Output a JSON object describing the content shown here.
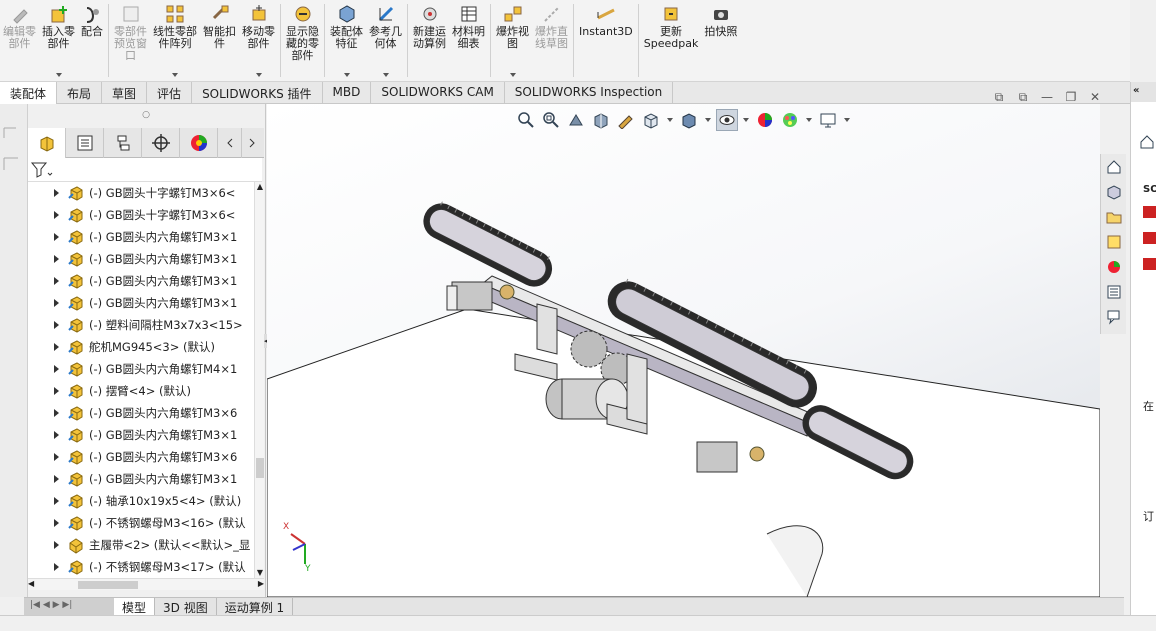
{
  "ribbon": {
    "buttons": [
      {
        "label": "编辑零\n部件",
        "icon": "edit-part-icon",
        "disabled": true,
        "dropdown": false
      },
      {
        "label": "插入零\n部件",
        "icon": "insert-component-icon",
        "disabled": false,
        "dropdown": true
      },
      {
        "label": "配合",
        "icon": "mate-icon",
        "disabled": false,
        "dropdown": false
      },
      {
        "label": "零部件\n预览窗\n口",
        "icon": "component-preview-icon",
        "disabled": true,
        "dropdown": false
      },
      {
        "label": "线性零部\n件阵列",
        "icon": "linear-pattern-icon",
        "disabled": false,
        "dropdown": true
      },
      {
        "label": "智能扣\n件",
        "icon": "smart-fastener-icon",
        "disabled": false,
        "dropdown": false
      },
      {
        "label": "移动零\n部件",
        "icon": "move-component-icon",
        "disabled": false,
        "dropdown": true
      },
      {
        "label": "显示隐\n藏的零\n部件",
        "icon": "show-hidden-icon",
        "disabled": false,
        "dropdown": false
      },
      {
        "label": "装配体\n特征",
        "icon": "assembly-feature-icon",
        "disabled": false,
        "dropdown": true
      },
      {
        "label": "参考几\n何体",
        "icon": "reference-geometry-icon",
        "disabled": false,
        "dropdown": true
      },
      {
        "label": "新建运\n动算例",
        "icon": "motion-study-icon",
        "disabled": false,
        "dropdown": false
      },
      {
        "label": "材料明\n细表",
        "icon": "bom-icon",
        "disabled": false,
        "dropdown": false
      },
      {
        "label": "爆炸视\n图",
        "icon": "exploded-view-icon",
        "disabled": false,
        "dropdown": true
      },
      {
        "label": "爆炸直\n线草图",
        "icon": "explode-line-icon",
        "disabled": true,
        "dropdown": false
      },
      {
        "label": "Instant3D",
        "icon": "instant3d-icon",
        "disabled": false,
        "dropdown": false
      },
      {
        "label": "更新\nSpeedpak",
        "icon": "speedpak-icon",
        "disabled": false,
        "dropdown": false
      },
      {
        "label": "拍快照",
        "icon": "snapshot-icon",
        "disabled": false,
        "dropdown": false
      }
    ]
  },
  "tabs": [
    "装配体",
    "布局",
    "草图",
    "评估",
    "SOLIDWORKS 插件",
    "MBD",
    "SOLIDWORKS CAM",
    "SOLIDWORKS Inspection"
  ],
  "tree": {
    "items": [
      {
        "label": "(-) GB圆头十字螺钉M3×6<",
        "icon": "part-icon"
      },
      {
        "label": "(-) GB圆头十字螺钉M3×6<",
        "icon": "part-icon"
      },
      {
        "label": "(-) GB圆头内六角螺钉M3×1",
        "icon": "part-icon"
      },
      {
        "label": "(-) GB圆头内六角螺钉M3×1",
        "icon": "part-icon"
      },
      {
        "label": "(-) GB圆头内六角螺钉M3×1",
        "icon": "part-icon"
      },
      {
        "label": "(-) GB圆头内六角螺钉M3×1",
        "icon": "part-icon"
      },
      {
        "label": "(-) 塑料间隔柱M3x7x3<15>",
        "icon": "part-icon"
      },
      {
        "label": "舵机MG945<3> (默认)",
        "icon": "part-icon"
      },
      {
        "label": "(-) GB圆头内六角螺钉M4×1",
        "icon": "part-icon"
      },
      {
        "label": "(-) 摆臂<4> (默认)",
        "icon": "part-icon"
      },
      {
        "label": "(-) GB圆头内六角螺钉M3×6",
        "icon": "part-icon"
      },
      {
        "label": "(-) GB圆头内六角螺钉M3×1",
        "icon": "part-icon"
      },
      {
        "label": "(-) GB圆头内六角螺钉M3×6",
        "icon": "part-icon"
      },
      {
        "label": "(-) GB圆头内六角螺钉M3×1",
        "icon": "part-icon"
      },
      {
        "label": "(-) 轴承10x19x5<4> (默认)",
        "icon": "part-icon"
      },
      {
        "label": "(-) 不锈钢螺母M3<16> (默认",
        "icon": "part-icon"
      },
      {
        "label": "主履带<2> (默认<<默认>_显",
        "icon": "subassembly-icon"
      },
      {
        "label": "(-) 不锈钢螺母M3<17> (默认",
        "icon": "part-icon"
      }
    ]
  },
  "triad": {
    "x": "X",
    "y": "Y"
  },
  "bottom_tabs": [
    "模型",
    "3D 视图",
    "运动算例 1"
  ],
  "right_pane": {
    "label_so": "SO",
    "label_zai": "在",
    "label_ding": "订"
  }
}
